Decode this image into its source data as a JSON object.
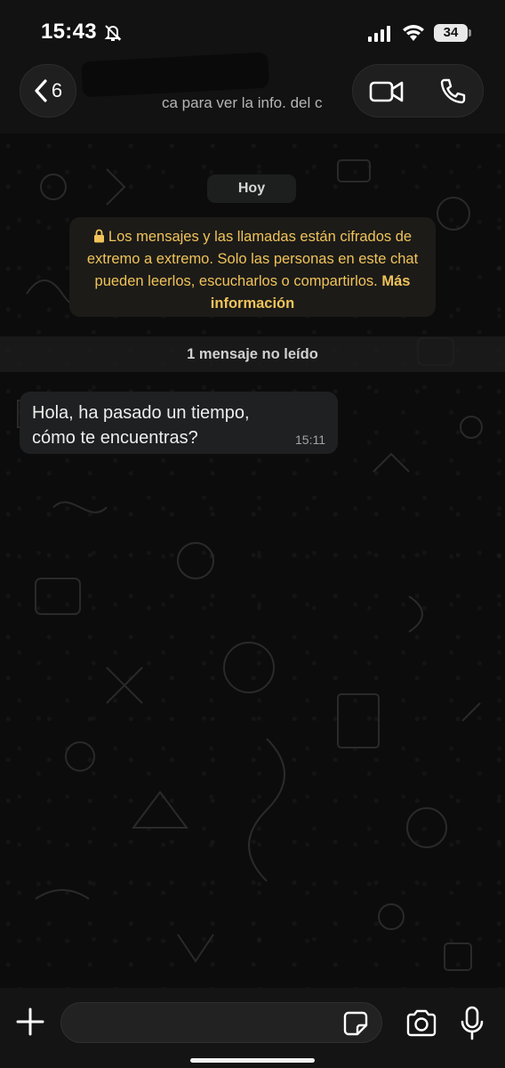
{
  "status_bar": {
    "time": "15:43",
    "battery": "34",
    "icons": [
      "bell-slash-icon",
      "cellular-signal-icon",
      "wifi-icon",
      "battery-icon"
    ]
  },
  "header": {
    "back_count": "6",
    "subtitle": "ca para ver la info. del c",
    "icons": [
      "chevron-left-icon",
      "video-camera-icon",
      "phone-icon"
    ]
  },
  "chat": {
    "day_label": "Hoy",
    "encryption_text": "Los mensajes y las llamadas están cifrados de extremo a extremo. Solo las personas en este chat pueden leerlos, escucharlos o compartirlos.",
    "encryption_link": "Más información",
    "unread_label": "1 mensaje no leído",
    "messages": [
      {
        "text": "Hola, ha pasado un tiempo, cómo te encuentras?",
        "time": "15:11",
        "direction": "incoming"
      }
    ]
  },
  "input_bar": {
    "value": "",
    "icons": [
      "plus-icon",
      "sticker-icon",
      "camera-icon",
      "microphone-icon"
    ]
  },
  "colors": {
    "background": "#0b0b0b",
    "bubble": "#1f2021",
    "notice_text": "#f0c35a",
    "notice_bg": "#1c1b18"
  }
}
